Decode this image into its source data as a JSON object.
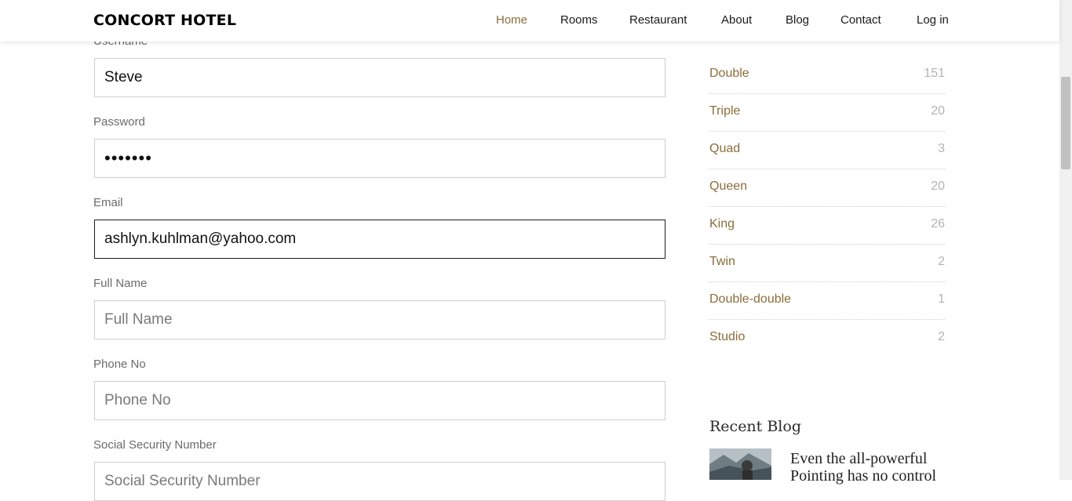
{
  "brand": "CONCORT HOTEL",
  "nav": {
    "items": [
      {
        "label": "Home",
        "active": true
      },
      {
        "label": "Rooms",
        "active": false
      },
      {
        "label": "Restaurant",
        "active": false
      },
      {
        "label": "About",
        "active": false
      },
      {
        "label": "Blog",
        "active": false
      },
      {
        "label": "Contact",
        "active": false
      },
      {
        "label": "Log in",
        "active": false
      }
    ]
  },
  "form": {
    "username": {
      "label": "Username",
      "value": "Steve"
    },
    "password": {
      "label": "Password",
      "value": "•••••••"
    },
    "email": {
      "label": "Email",
      "value": "ashlyn.kuhlman@yahoo.com"
    },
    "full_name": {
      "label": "Full Name",
      "placeholder": "Full Name"
    },
    "phone": {
      "label": "Phone No",
      "placeholder": "Phone No"
    },
    "ssn": {
      "label": "Social Security Number",
      "placeholder": "Social Security Number"
    }
  },
  "sidebar": {
    "categories": [
      {
        "name": "Double",
        "count": "151"
      },
      {
        "name": "Triple",
        "count": "20"
      },
      {
        "name": "Quad",
        "count": "3"
      },
      {
        "name": "Queen",
        "count": "20"
      },
      {
        "name": "King",
        "count": "26"
      },
      {
        "name": "Twin",
        "count": "2"
      },
      {
        "name": "Double-double",
        "count": "1"
      },
      {
        "name": "Studio",
        "count": "2"
      }
    ],
    "recent_blog": {
      "title": "Recent Blog",
      "post_title": "Even the all-powerful Pointing has no control"
    }
  },
  "colors": {
    "accent": "#8a6d3b",
    "count": "#b3b3b3"
  }
}
